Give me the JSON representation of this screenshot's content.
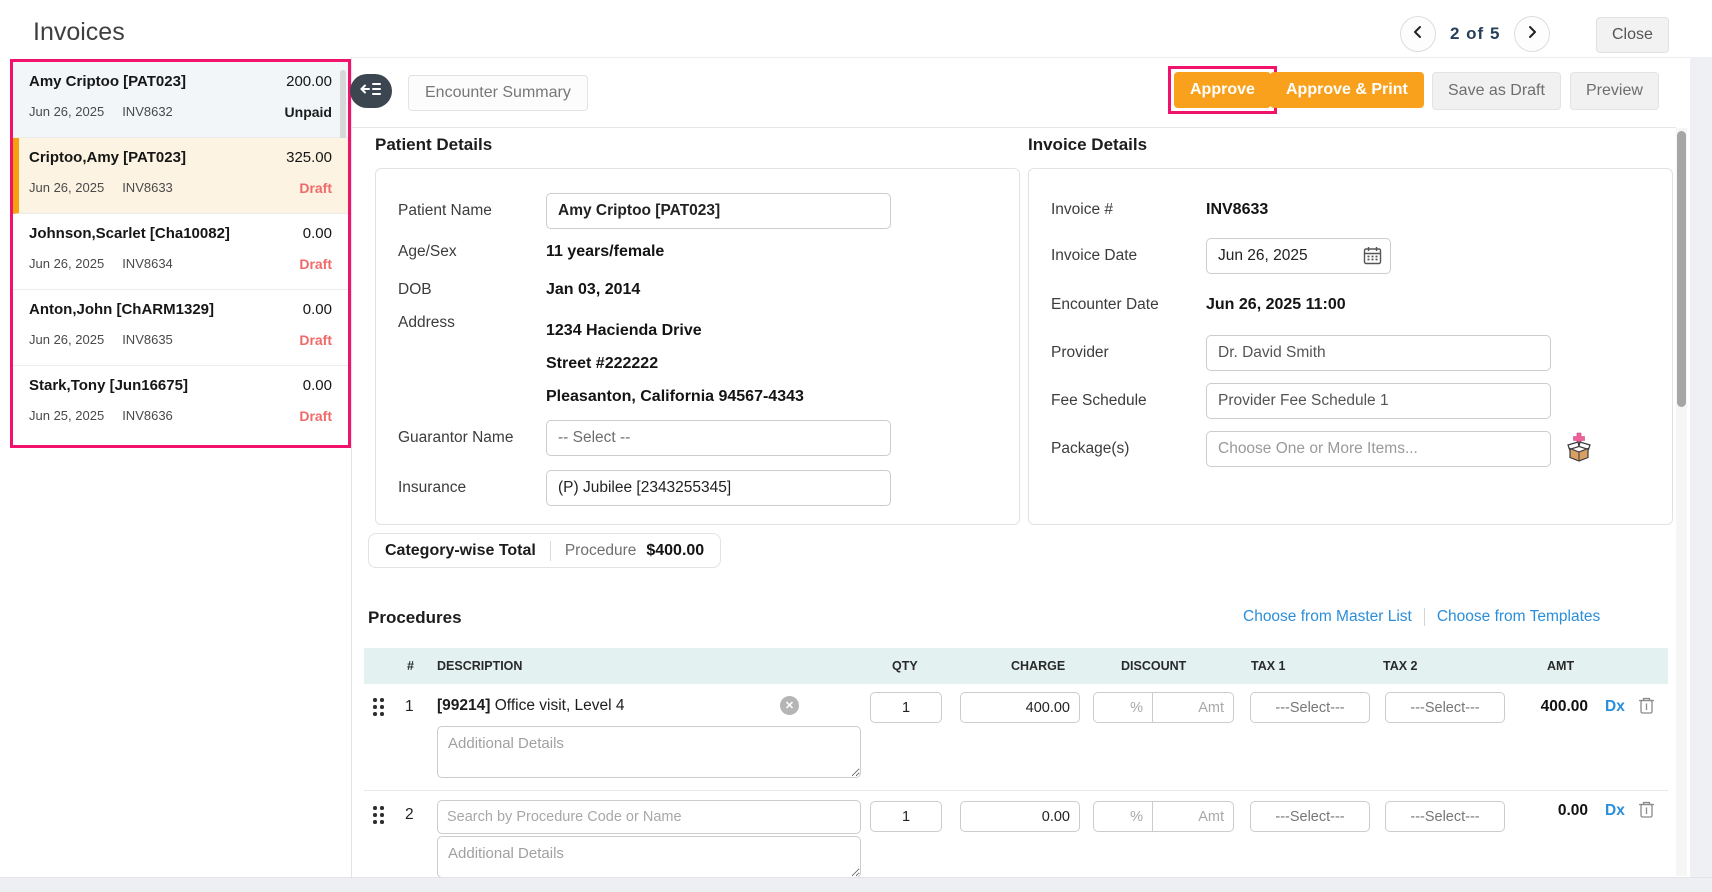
{
  "header": {
    "title": "Invoices",
    "pagination": "2 of 5",
    "close_label": "Close"
  },
  "sidebar": {
    "items": [
      {
        "name": "Amy Criptoo [PAT023]",
        "amount": "200.00",
        "date": "Jun 26, 2025",
        "invoice": "INV8632",
        "status": "Unpaid"
      },
      {
        "name": "Criptoo,Amy [PAT023]",
        "amount": "325.00",
        "date": "Jun 26, 2025",
        "invoice": "INV8633",
        "status": "Draft"
      },
      {
        "name": "Johnson,Scarlet [Cha10082]",
        "amount": "0.00",
        "date": "Jun 26, 2025",
        "invoice": "INV8634",
        "status": "Draft"
      },
      {
        "name": "Anton,John [ChARM1329]",
        "amount": "0.00",
        "date": "Jun 26, 2025",
        "invoice": "INV8635",
        "status": "Draft"
      },
      {
        "name": "Stark,Tony [Jun16675]",
        "amount": "0.00",
        "date": "Jun 25, 2025",
        "invoice": "INV8636",
        "status": "Draft"
      }
    ]
  },
  "toolbar": {
    "encounter_summary_label": "Encounter Summary",
    "approve_label": "Approve",
    "approve_print_label": "Approve & Print",
    "save_draft_label": "Save as Draft",
    "preview_label": "Preview"
  },
  "patient_details": {
    "title": "Patient Details",
    "patient_name_label": "Patient Name",
    "patient_name_value": "Amy Criptoo [PAT023]",
    "age_sex_label": "Age/Sex",
    "age_sex_value": "11 years/female",
    "dob_label": "DOB",
    "dob_value": "Jan 03, 2014",
    "address_label": "Address",
    "address_lines": [
      "1234 Hacienda Drive",
      "Street #222222",
      "Pleasanton, California 94567-4343"
    ],
    "guarantor_label": "Guarantor Name",
    "guarantor_value": "-- Select --",
    "insurance_label": "Insurance",
    "insurance_value": "(P) Jubilee [2343255345]"
  },
  "invoice_details": {
    "title": "Invoice Details",
    "invoice_no_label": "Invoice #",
    "invoice_no_value": "INV8633",
    "invoice_date_label": "Invoice Date",
    "invoice_date_value": "Jun 26, 2025",
    "encounter_date_label": "Encounter Date",
    "encounter_date_value": "Jun 26, 2025 11:00",
    "provider_label": "Provider",
    "provider_value": "Dr. David Smith",
    "fee_schedule_label": "Fee Schedule",
    "fee_schedule_value": "Provider Fee Schedule 1",
    "packages_label": "Package(s)",
    "packages_placeholder": "Choose One or More Items..."
  },
  "category_total": {
    "label": "Category-wise Total",
    "category": "Procedure",
    "amount": "$400.00"
  },
  "procedures": {
    "title": "Procedures",
    "link_master": "Choose from Master List",
    "link_templates": "Choose from Templates",
    "columns": [
      "#",
      "DESCRIPTION",
      "QTY",
      "CHARGE",
      "DISCOUNT",
      "TAX 1",
      "TAX 2",
      "AMT"
    ],
    "placeholders": {
      "discount_pct": "%",
      "discount_amt": "Amt",
      "tax": "---Select---",
      "additional_details": "Additional Details",
      "search": "Search by Procedure Code or Name"
    },
    "dx_label": "Dx",
    "rows": [
      {
        "num": "1",
        "code": "[99214]",
        "name": " Office visit, Level 4",
        "qty": "1",
        "charge": "400.00",
        "amt": "400.00"
      },
      {
        "num": "2",
        "qty": "1",
        "charge": "0.00",
        "amt": "0.00"
      }
    ]
  },
  "colors": {
    "accent_orange": "#F9A11D",
    "highlight_pink": "#F0126B",
    "draft_red": "#F06A6A",
    "link_blue": "#2B8ED9",
    "selected_item_bg": "#FCF3E2",
    "table_header_bg": "#E3F2F1"
  }
}
